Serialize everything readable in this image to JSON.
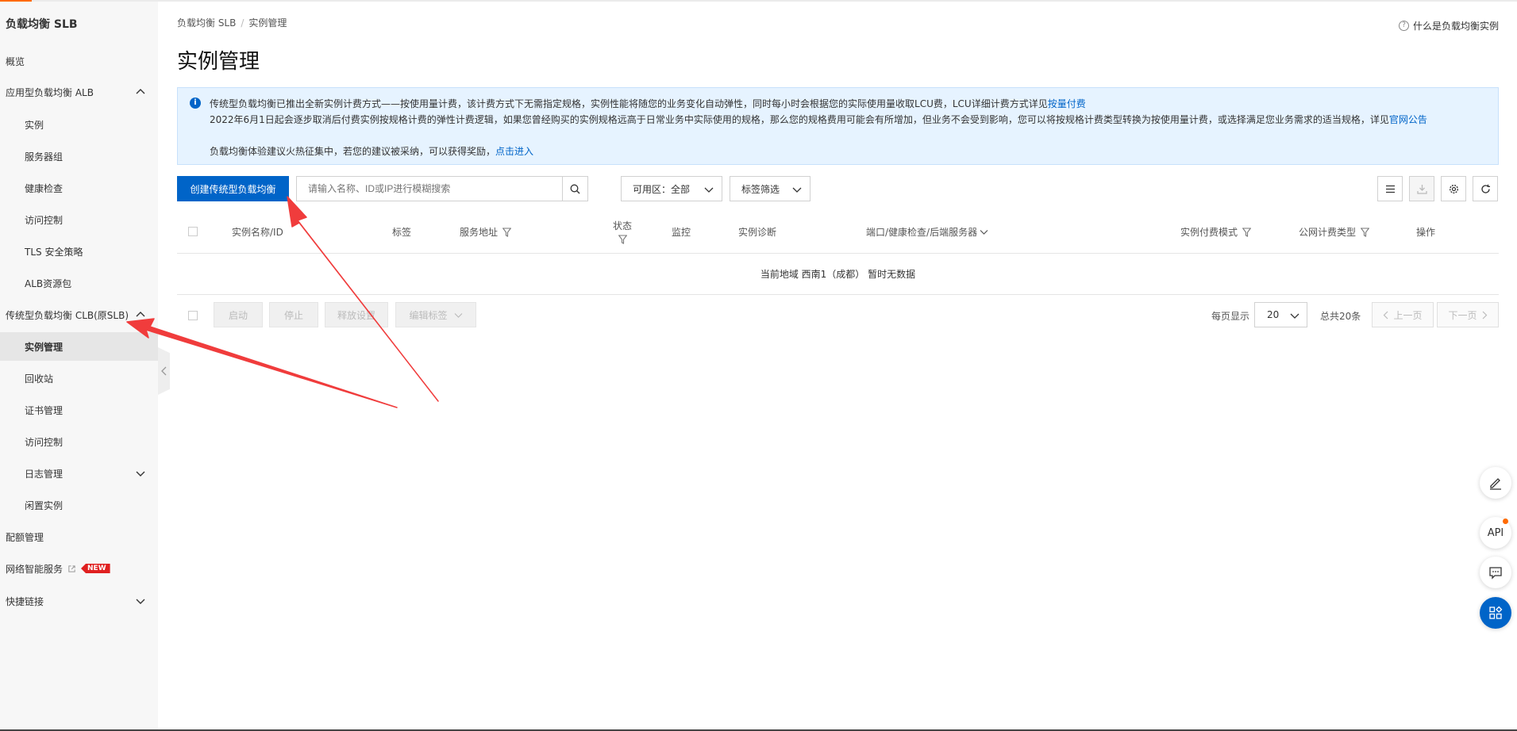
{
  "sidebar": {
    "title": "负载均衡 SLB",
    "items": [
      {
        "label": "概览"
      },
      {
        "label": "应用型负载均衡 ALB"
      },
      {
        "label": "实例"
      },
      {
        "label": "服务器组"
      },
      {
        "label": "健康检查"
      },
      {
        "label": "访问控制"
      },
      {
        "label": "TLS 安全策略"
      },
      {
        "label": "ALB资源包"
      },
      {
        "label": "传统型负载均衡 CLB(原SLB)"
      },
      {
        "label": "实例管理"
      },
      {
        "label": "回收站"
      },
      {
        "label": "证书管理"
      },
      {
        "label": "访问控制"
      },
      {
        "label": "日志管理"
      },
      {
        "label": "闲置实例"
      },
      {
        "label": "配额管理"
      },
      {
        "label": "网络智能服务",
        "badge": "NEW"
      },
      {
        "label": "快捷链接"
      }
    ]
  },
  "breadcrumb": {
    "root": "负载均衡 SLB",
    "sep": "/",
    "current": "实例管理"
  },
  "help_link": "什么是负载均衡实例",
  "page_title": "实例管理",
  "notice": {
    "line1": "传统型负载均衡已推出全新实例计费方式——按使用量计费，该计费方式下无需指定规格，实例性能将随您的业务变化自动弹性，同时每小时会根据您的实际使用量收取LCU费，LCU详细计费方式详见",
    "line1_link": "按量付费",
    "line2": "2022年6月1日起会逐步取消后付费实例按规格计费的弹性计费逻辑，如果您曾经购买的实例规格远高于日常业务中实际使用的规格，那么您的规格费用可能会有所增加，但业务不会受到影响，您可以将按规格计费类型转换为按使用量计费，或选择满足您业务需求的适当规格，详见",
    "line2_link": "官网公告",
    "line3": "负载均衡体验建议火热征集中，若您的建议被采纳，可以获得奖励，",
    "line3_link": "点击进入"
  },
  "toolbar": {
    "create_label": "创建传统型负载均衡",
    "search_placeholder": "请输入名称、ID或IP进行模糊搜索",
    "zone_label": "可用区：全部",
    "tag_filter_label": "标签筛选"
  },
  "table": {
    "columns": [
      "实例名称/ID",
      "标签",
      "服务地址",
      "状态",
      "监控",
      "实例诊断",
      "端口/健康检查/后端服务器",
      "实例付费模式",
      "公网计费类型",
      "操作"
    ],
    "empty_text": "当前地域 西南1（成都） 暂时无数据"
  },
  "footer": {
    "start": "启动",
    "stop": "停止",
    "release": "释放设置",
    "edit_tags": "编辑标签",
    "per_page_label": "每页显示",
    "per_page_value": "20",
    "total": "总共20条",
    "prev": "上一页",
    "next": "下一页"
  },
  "float_buttons": {
    "api": "API"
  },
  "colors": {
    "primary": "#0064c8",
    "accent": "#ff6a00",
    "annotation": "#f03c3c",
    "notice_bg": "#e6f3ff"
  }
}
